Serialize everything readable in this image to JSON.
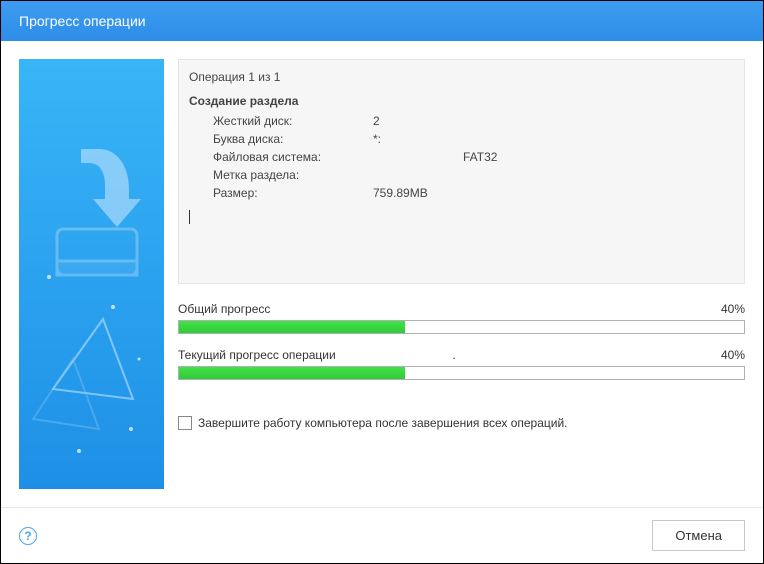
{
  "titlebar": {
    "title": "Прогресс операции"
  },
  "operation": {
    "count_text": "Операция 1 из 1",
    "title": "Создание раздела",
    "details": {
      "disk_label": "Жесткий диск:",
      "disk_value": "2",
      "letter_label": "Буква диска:",
      "letter_value": "*:",
      "fs_label": "Файловая система:",
      "fs_value": "FAT32",
      "volume_label": "Метка раздела:",
      "volume_value": "",
      "size_label": "Размер:",
      "size_value": "759.89MB"
    }
  },
  "progress": {
    "overall": {
      "label": "Общий прогресс",
      "percent_text": "40%",
      "percent": 40
    },
    "current": {
      "label": "Текущий прогресс операции",
      "detail": ".",
      "percent_text": "40%",
      "percent": 40
    }
  },
  "checkbox": {
    "label": "Завершите работу компьютера после завершения всех операций."
  },
  "footer": {
    "cancel": "Отмена"
  }
}
